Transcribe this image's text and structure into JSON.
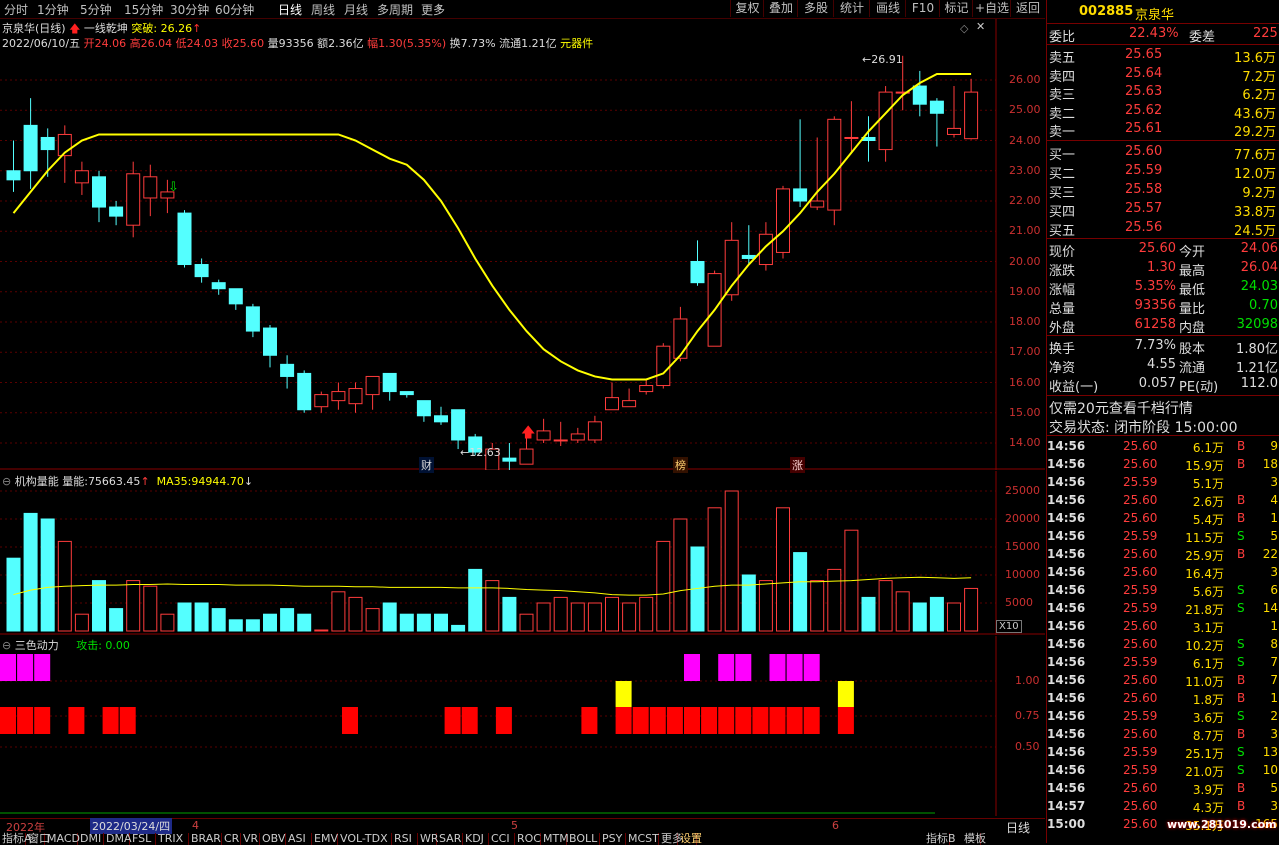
{
  "toolbar": {
    "periods": [
      "分时",
      "1分钟",
      "5分钟",
      "15分钟",
      "30分钟",
      "60分钟",
      "日线",
      "周线",
      "月线",
      "多周期",
      "更多"
    ],
    "active_period": "日线",
    "buttons": [
      "复权",
      "叠加",
      "多股",
      "统计",
      "画线",
      "F10",
      "标记",
      "+自选",
      "返回"
    ]
  },
  "main": {
    "title": "京泉华(日线)",
    "indicator_name": "一线乾坤",
    "indicator_tag": "突破:",
    "indicator_value": "26.26",
    "info": {
      "date": "2022/06/10/五",
      "open_label": "开",
      "open": "24.06",
      "high_label": "高",
      "high": "26.04",
      "low_label": "低",
      "low": "24.03",
      "close_label": "收",
      "close": "25.60",
      "vol_label": "量",
      "vol": "93356",
      "amount_label": "额",
      "amount": "2.36亿",
      "change_label": "幅",
      "change": "1.30(5.35%)",
      "turnover": "换7.73%",
      "float": "流通1.21亿",
      "tag": "元器件"
    },
    "y_ticks": [
      "26.00",
      "25.00",
      "24.00",
      "23.00",
      "22.00",
      "21.00",
      "20.00",
      "19.00",
      "18.00",
      "17.00",
      "16.00",
      "15.00",
      "14.00"
    ],
    "max_label": "26.91",
    "min_label": "12.63",
    "event_marks": [
      "财",
      "榜",
      "涨"
    ]
  },
  "volume": {
    "title": "机构量能",
    "vol_label": "量能:",
    "vol_value": "75663.45",
    "ma_label": "MA35:",
    "ma_value": "94944.70",
    "y_ticks": [
      "25000",
      "20000",
      "15000",
      "10000",
      "5000"
    ],
    "scale": "X10"
  },
  "dynamics": {
    "title": "三色动力",
    "attack_label": "攻击:",
    "attack_value": "0.00",
    "y_ticks": [
      "1.00",
      "0.75",
      "0.50"
    ]
  },
  "xaxis": {
    "year": "2022年",
    "cursor_date": "2022/03/24/四",
    "months": [
      "4",
      "5",
      "6"
    ],
    "mode": "日线"
  },
  "indicator_tabs": [
    "指标A",
    "窗口",
    "MACD",
    "DMI",
    "DMA",
    "FSL",
    "TRIX",
    "BRAR",
    "CR",
    "VR",
    "OBV",
    "ASI",
    "EMV",
    "VOL-TDX",
    "RSI",
    "WR",
    "SAR",
    "KDJ",
    "CCI",
    "ROC",
    "MTM",
    "BOLL",
    "PSY",
    "MCST",
    "更多",
    "设置",
    "指标B",
    "模板"
  ],
  "quote": {
    "code": "002885",
    "name": "京泉华",
    "weibi_label": "委比",
    "weibi": "22.43%",
    "weicha_label": "委差",
    "weicha": "225",
    "sells": [
      {
        "label": "卖五",
        "price": "25.65",
        "vol": "13.6万"
      },
      {
        "label": "卖四",
        "price": "25.64",
        "vol": "7.2万"
      },
      {
        "label": "卖三",
        "price": "25.63",
        "vol": "6.2万"
      },
      {
        "label": "卖二",
        "price": "25.62",
        "vol": "43.6万"
      },
      {
        "label": "卖一",
        "price": "25.61",
        "vol": "29.2万"
      }
    ],
    "buys": [
      {
        "label": "买一",
        "price": "25.60",
        "vol": "77.6万"
      },
      {
        "label": "买二",
        "price": "25.59",
        "vol": "12.0万"
      },
      {
        "label": "买三",
        "price": "25.58",
        "vol": "9.2万"
      },
      {
        "label": "买四",
        "price": "25.57",
        "vol": "33.8万"
      },
      {
        "label": "买五",
        "price": "25.56",
        "vol": "24.5万"
      }
    ],
    "stats": [
      {
        "l1": "现价",
        "v1": "25.60",
        "l2": "今开",
        "v2": "24.06"
      },
      {
        "l1": "涨跌",
        "v1": "1.30",
        "l2": "最高",
        "v2": "26.04"
      },
      {
        "l1": "涨幅",
        "v1": "5.35%",
        "l2": "最低",
        "v2": "24.03"
      },
      {
        "l1": "总量",
        "v1": "93356",
        "l2": "量比",
        "v2": "0.70"
      },
      {
        "l1": "外盘",
        "v1": "61258",
        "l2": "内盘",
        "v2": "32098"
      }
    ],
    "stats2": [
      {
        "l1": "换手",
        "v1": "7.73%",
        "l2": "股本",
        "v2": "1.80亿"
      },
      {
        "l1": "净资",
        "v1": "4.55",
        "l2": "流通",
        "v2": "1.21亿"
      },
      {
        "l1": "收益(一)",
        "v1": "0.057",
        "l2": "PE(动)",
        "v2": "112.0"
      }
    ],
    "notice": "仅需20元查看千档行情",
    "status": "交易状态: 闭市阶段 15:00:00",
    "ticks": [
      {
        "t": "14:56",
        "p": "25.60",
        "v": "6.1万",
        "s": "B",
        "n": "9"
      },
      {
        "t": "14:56",
        "p": "25.60",
        "v": "15.9万",
        "s": "B",
        "n": "18"
      },
      {
        "t": "14:56",
        "p": "25.59",
        "v": "5.1万",
        "s": "",
        "n": "3"
      },
      {
        "t": "14:56",
        "p": "25.60",
        "v": "2.6万",
        "s": "B",
        "n": "4"
      },
      {
        "t": "14:56",
        "p": "25.60",
        "v": "5.4万",
        "s": "B",
        "n": "1"
      },
      {
        "t": "14:56",
        "p": "25.59",
        "v": "11.5万",
        "s": "S",
        "n": "5"
      },
      {
        "t": "14:56",
        "p": "25.60",
        "v": "25.9万",
        "s": "B",
        "n": "22"
      },
      {
        "t": "14:56",
        "p": "25.60",
        "v": "16.4万",
        "s": "",
        "n": "3"
      },
      {
        "t": "14:56",
        "p": "25.59",
        "v": "5.6万",
        "s": "S",
        "n": "6"
      },
      {
        "t": "14:56",
        "p": "25.59",
        "v": "21.8万",
        "s": "S",
        "n": "14"
      },
      {
        "t": "14:56",
        "p": "25.60",
        "v": "3.1万",
        "s": "",
        "n": "1"
      },
      {
        "t": "14:56",
        "p": "25.60",
        "v": "10.2万",
        "s": "S",
        "n": "8"
      },
      {
        "t": "14:56",
        "p": "25.59",
        "v": "6.1万",
        "s": "S",
        "n": "7"
      },
      {
        "t": "14:56",
        "p": "25.60",
        "v": "11.0万",
        "s": "B",
        "n": "7"
      },
      {
        "t": "14:56",
        "p": "25.60",
        "v": "1.8万",
        "s": "B",
        "n": "1"
      },
      {
        "t": "14:56",
        "p": "25.59",
        "v": "3.6万",
        "s": "S",
        "n": "2"
      },
      {
        "t": "14:56",
        "p": "25.60",
        "v": "8.7万",
        "s": "B",
        "n": "3"
      },
      {
        "t": "14:56",
        "p": "25.59",
        "v": "25.1万",
        "s": "S",
        "n": "13"
      },
      {
        "t": "14:56",
        "p": "25.59",
        "v": "21.0万",
        "s": "S",
        "n": "10"
      },
      {
        "t": "14:56",
        "p": "25.60",
        "v": "3.9万",
        "s": "B",
        "n": "5"
      },
      {
        "t": "14:57",
        "p": "25.60",
        "v": "4.3万",
        "s": "B",
        "n": "3"
      },
      {
        "t": "15:00",
        "p": "25.60",
        "v": "35.1万",
        "s": "",
        "n": "165"
      }
    ],
    "watermark": "www.281019.com"
  },
  "colors": {
    "up": "#ff3c3c",
    "down": "#54ffff",
    "ma": "#ffff00",
    "magenta": "#ff00ff",
    "yellow": "#ffff00",
    "red": "#ff0000"
  },
  "chart_data": {
    "type": "candlestick",
    "ylim": [
      12.3,
      27.3
    ],
    "candles": [
      [
        23.0,
        22.7,
        24.0,
        22.3
      ],
      [
        24.5,
        23.0,
        25.4,
        22.4
      ],
      [
        24.1,
        23.7,
        24.4,
        22.8
      ],
      [
        23.5,
        24.2,
        24.5,
        22.6
      ],
      [
        22.6,
        23.0,
        23.3,
        22.2
      ],
      [
        22.8,
        21.8,
        23.0,
        21.3
      ],
      [
        21.8,
        21.5,
        22.0,
        21.2
      ],
      [
        21.2,
        22.9,
        23.3,
        20.8
      ],
      [
        22.1,
        22.8,
        23.2,
        21.5
      ],
      [
        22.1,
        22.3,
        22.7,
        21.6
      ],
      [
        21.6,
        19.9,
        21.7,
        19.8
      ],
      [
        19.9,
        19.5,
        20.1,
        19.3
      ],
      [
        19.3,
        19.1,
        19.4,
        18.9
      ],
      [
        19.1,
        18.6,
        19.1,
        18.4
      ],
      [
        18.5,
        17.7,
        18.6,
        17.5
      ],
      [
        17.8,
        16.9,
        17.9,
        16.5
      ],
      [
        16.6,
        16.2,
        16.9,
        15.8
      ],
      [
        16.3,
        15.1,
        16.4,
        15.0
      ],
      [
        15.2,
        15.6,
        15.7,
        15.0
      ],
      [
        15.4,
        15.7,
        16.0,
        15.1
      ],
      [
        15.3,
        15.8,
        16.0,
        15.0
      ],
      [
        15.6,
        16.2,
        16.2,
        15.1
      ],
      [
        16.3,
        15.7,
        16.3,
        15.4
      ],
      [
        15.7,
        15.6,
        15.7,
        15.5
      ],
      [
        15.4,
        14.9,
        15.4,
        14.7
      ],
      [
        14.9,
        14.7,
        15.2,
        14.6
      ],
      [
        15.1,
        14.1,
        15.1,
        13.8
      ],
      [
        14.2,
        13.7,
        14.3,
        13.6
      ],
      [
        13.1,
        13.8,
        14.0,
        12.8
      ],
      [
        13.5,
        13.4,
        14.0,
        12.8
      ],
      [
        13.3,
        13.8,
        14.3,
        13.3
      ],
      [
        14.1,
        14.4,
        14.8,
        14.0
      ],
      [
        14.1,
        14.1,
        14.7,
        13.9
      ],
      [
        14.1,
        14.3,
        14.5,
        14.0
      ],
      [
        14.1,
        14.7,
        14.9,
        14.0
      ],
      [
        15.1,
        15.5,
        16.0,
        15.1
      ],
      [
        15.2,
        15.4,
        15.8,
        15.2
      ],
      [
        15.7,
        15.9,
        16.1,
        15.6
      ],
      [
        15.9,
        17.2,
        17.3,
        15.8
      ],
      [
        16.8,
        18.1,
        18.5,
        16.7
      ],
      [
        20.0,
        19.3,
        20.7,
        19.2
      ],
      [
        17.2,
        19.6,
        19.7,
        17.2
      ],
      [
        18.9,
        20.7,
        21.3,
        18.7
      ],
      [
        20.2,
        20.1,
        21.2,
        19.9
      ],
      [
        19.9,
        20.9,
        21.3,
        19.7
      ],
      [
        20.3,
        22.4,
        22.5,
        20.1
      ],
      [
        22.4,
        22.0,
        24.7,
        21.8
      ],
      [
        21.8,
        22.0,
        24.1,
        21.7
      ],
      [
        21.7,
        24.7,
        24.8,
        21.2
      ],
      [
        24.1,
        24.1,
        25.3,
        23.6
      ],
      [
        24.1,
        24.0,
        24.8,
        23.3
      ],
      [
        23.7,
        25.6,
        25.8,
        23.3
      ],
      [
        25.6,
        25.6,
        26.8,
        25.0
      ],
      [
        25.8,
        25.2,
        26.3,
        24.8
      ],
      [
        25.3,
        24.9,
        25.4,
        23.8
      ],
      [
        24.2,
        24.4,
        25.8,
        24.1
      ],
      [
        24.06,
        25.6,
        26.04,
        24.03
      ]
    ],
    "ma": [
      21.6,
      22.3,
      23.0,
      23.6,
      24.0,
      24.2,
      24.2,
      24.2,
      24.2,
      24.2,
      24.2,
      24.2,
      24.2,
      24.2,
      24.2,
      24.2,
      24.2,
      24.2,
      24.2,
      24.2,
      24.0,
      23.7,
      23.4,
      23.2,
      22.7,
      22.0,
      21.1,
      20.1,
      19.2,
      18.4,
      17.7,
      17.1,
      16.7,
      16.4,
      16.2,
      16.1,
      16.1,
      16.1,
      16.3,
      16.9,
      17.7,
      18.4,
      19.2,
      19.9,
      20.5,
      21.0,
      21.6,
      22.3,
      22.9,
      23.6,
      24.3,
      24.9,
      25.5,
      25.9,
      26.2,
      26.2,
      26.2
    ],
    "volume": [
      13,
      21,
      20,
      16,
      3,
      9,
      4,
      9,
      8,
      3,
      5,
      5,
      4,
      2,
      2,
      3,
      4,
      3,
      0,
      7,
      6,
      4,
      5,
      3,
      3,
      3,
      1,
      11,
      9,
      6,
      3,
      5,
      6,
      5,
      5,
      6,
      5,
      6,
      16,
      20,
      15,
      22,
      25,
      10,
      9,
      22,
      14,
      9,
      11,
      18,
      6,
      9,
      7,
      5,
      6,
      5,
      7.6
    ],
    "vol_ma": [
      6.5,
      7.3,
      7.8,
      8.0,
      8.1,
      8.2,
      8.2,
      8.3,
      8.3,
      8.4,
      8.3,
      8.3,
      8.3,
      8.2,
      8.2,
      8.2,
      8.1,
      8.0,
      8.0,
      8.0,
      7.9,
      7.9,
      7.8,
      7.8,
      7.8,
      7.8,
      7.7,
      7.7,
      7.7,
      7.6,
      7.4,
      7.3,
      7.2,
      7.0,
      6.8,
      6.5,
      6.4,
      6.4,
      6.6,
      7.2,
      7.6,
      8.0,
      8.2,
      8.2,
      8.4,
      8.6,
      8.8,
      8.8,
      8.9,
      9.0,
      9.2,
      9.4,
      9.5,
      9.6,
      9.5,
      9.4,
      9.5
    ],
    "vol_ylim": [
      0,
      27000
    ],
    "magenta": [
      0,
      1,
      2,
      40,
      42,
      43,
      45,
      46,
      47
    ],
    "yellow": [
      36,
      49
    ],
    "red": [
      0,
      1,
      2,
      4,
      6,
      7,
      20,
      26,
      27,
      29,
      34,
      36,
      37,
      38,
      39,
      40,
      41,
      42,
      43,
      44,
      45,
      46,
      47,
      49
    ]
  }
}
